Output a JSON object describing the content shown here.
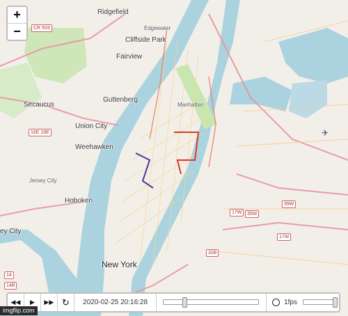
{
  "zoom": {
    "in_label": "+",
    "out_label": "−"
  },
  "labels": [
    {
      "id": "ridgefield",
      "text": "Ridgefield"
    },
    {
      "id": "edgewater",
      "text": "Edgewater"
    },
    {
      "id": "cliffside",
      "text": "Cliffside Park"
    },
    {
      "id": "fairview",
      "text": "Fairview"
    },
    {
      "id": "guttenberg",
      "text": "Guttenberg"
    },
    {
      "id": "manhattan",
      "text": "Manhattan"
    },
    {
      "id": "secaucus",
      "text": "Secaucus"
    },
    {
      "id": "union_city",
      "text": "Union City"
    },
    {
      "id": "weehawken",
      "text": "Weehawken"
    },
    {
      "id": "hoboken",
      "text": "Hoboken"
    },
    {
      "id": "jersey_city",
      "text": "Jersey City"
    },
    {
      "id": "ey_city",
      "text": "ey City"
    },
    {
      "id": "new_york",
      "text": "New York"
    }
  ],
  "shields": [
    {
      "id": "cr503",
      "text": "CR 503"
    },
    {
      "id": "s16e",
      "text": "16E 18E"
    },
    {
      "id": "s14",
      "text": "14"
    },
    {
      "id": "s14b",
      "text": "14B"
    },
    {
      "id": "s17w",
      "text": "17W"
    },
    {
      "id": "s35w",
      "text": "35W"
    },
    {
      "id": "s39w",
      "text": "39W"
    },
    {
      "id": "s32b",
      "text": "32B"
    },
    {
      "id": "s17w2",
      "text": "17W"
    }
  ],
  "playback": {
    "rewind_icon": "rewind-icon",
    "play_icon": "play-icon",
    "forward_icon": "fast-forward-icon",
    "reload_icon": "reload-icon",
    "timestamp": "2020-02-25 20:16:28",
    "progress": 0.2,
    "fps_label": "1fps",
    "fps_level": 1.0
  },
  "watermark": "imgflip.com",
  "colors": {
    "water": "#aad3df",
    "land": "#f2efe9",
    "park": "#c8e6b0",
    "major_road": "#e892a2",
    "route_red": "#d63a2a",
    "route_purple": "#4b3a9a"
  }
}
